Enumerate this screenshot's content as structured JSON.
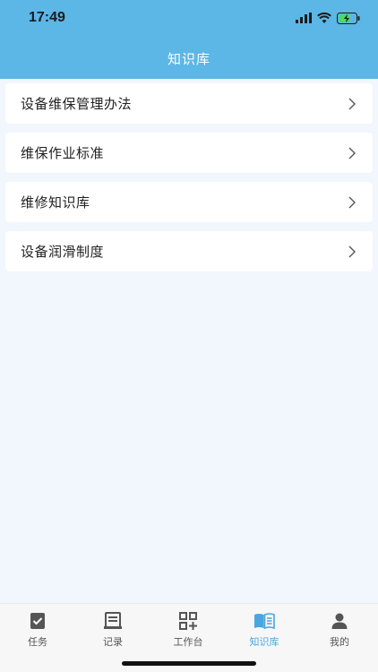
{
  "status_bar": {
    "time": "17:49",
    "icons": [
      "signal-icon",
      "wifi-icon",
      "battery-charging-icon"
    ]
  },
  "header": {
    "title": "知识库",
    "background_color": "#5cb6e6"
  },
  "list": {
    "items": [
      {
        "label": "设备维保管理办法",
        "icon": "chevron-right-icon"
      },
      {
        "label": "维保作业标准",
        "icon": "chevron-right-icon"
      },
      {
        "label": "维修知识库",
        "icon": "chevron-right-icon"
      },
      {
        "label": "设备润滑制度",
        "icon": "chevron-right-icon"
      }
    ]
  },
  "tabbar": {
    "active_color": "#4aa6df",
    "tabs": [
      {
        "label": "任务",
        "icon": "task-check-icon",
        "active": false
      },
      {
        "label": "记录",
        "icon": "record-icon",
        "active": false
      },
      {
        "label": "工作台",
        "icon": "workbench-grid-icon",
        "active": false
      },
      {
        "label": "知识库",
        "icon": "book-icon",
        "active": true
      },
      {
        "label": "我的",
        "icon": "user-icon",
        "active": false
      }
    ]
  }
}
